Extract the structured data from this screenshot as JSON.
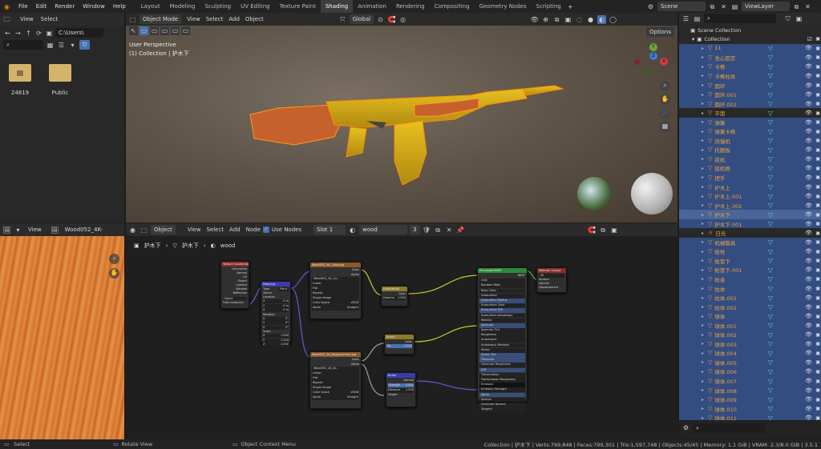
{
  "menu": [
    "File",
    "Edit",
    "Render",
    "Window",
    "Help"
  ],
  "workspaces": [
    "Layout",
    "Modeling",
    "Sculpting",
    "UV Editing",
    "Texture Paint",
    "Shading",
    "Animation",
    "Rendering",
    "Compositing",
    "Geometry Nodes",
    "Scripting"
  ],
  "active_workspace": "Shading",
  "scene": "Scene",
  "view_layer": "ViewLayer",
  "file_browser": {
    "menu": [
      "View",
      "Select"
    ],
    "path": "C:\\Users\\",
    "items": [
      {
        "name": "24819"
      },
      {
        "name": "Public"
      }
    ]
  },
  "viewport": {
    "mode": "Object Mode",
    "menu": [
      "View",
      "Select",
      "Add",
      "Object"
    ],
    "transform": "Global",
    "title": "User Perspective",
    "subtitle": "(1) Collection | 护木下",
    "options": "Options",
    "gizmo": {
      "y": "Y",
      "z": "Z",
      "x": "X"
    }
  },
  "image_editor": {
    "menu": "View",
    "image_name": "Wood052_4K-"
  },
  "node_editor": {
    "type": "Object",
    "menu": [
      "View",
      "Select",
      "Add",
      "Node"
    ],
    "use_nodes": "Use Nodes",
    "slot": "Slot 1",
    "material": "wood",
    "users": "3",
    "breadcrumb": [
      "护木下",
      "护木下",
      "wood"
    ],
    "nodes": {
      "texcoord": {
        "title": "Texture Coordinate",
        "outs": [
          "Generated",
          "Normal",
          "UV",
          "Object",
          "Camera",
          "Window",
          "Reflection"
        ],
        "object": "Object",
        "from": "From Instancer"
      },
      "mapping": {
        "title": "Mapping",
        "type_label": "Type",
        "type": "Point",
        "vector": "Vector",
        "location": "Location",
        "rotation": "Rotation",
        "scale": "Scale",
        "vals": [
          "0 m",
          "0 m",
          "0 m",
          "0°",
          "0°",
          "0°",
          "1.000",
          "1.000",
          "1.000"
        ],
        "axes": [
          "X",
          "Y",
          "Z",
          "X",
          "Y",
          "Z",
          "X",
          "Y",
          "Z"
        ]
      },
      "img1": {
        "title": "Wood052_4K_Color.jpg",
        "file": "Wood052_4K_Co...",
        "props": [
          "Linear",
          "Flat",
          "Repeat",
          "Single Image",
          "Color Space",
          "Alpha"
        ],
        "cs": "sRGB",
        "alpha": "Straight",
        "outs": [
          "Color",
          "Alpha"
        ]
      },
      "img2": {
        "title": "Wood052_4K_Displacement.jpg",
        "file": "Wood052_4K_Di...",
        "props": [
          "Linear",
          "Flat",
          "Repeat",
          "Single Image",
          "Color Space",
          "Alpha"
        ],
        "cs": "sRGB",
        "alpha": "Straight",
        "outs": [
          "Color",
          "Alpha"
        ]
      },
      "hsv": {
        "title": "Hue/Sat/Val",
        "color": "Color",
        "gamma": "Gamma",
        "gamma_val": "1.000"
      },
      "invert": {
        "title": "Invert",
        "fac": "Fac",
        "fac_val": "1.000",
        "color": "Color"
      },
      "bump": {
        "title": "Bump",
        "normal": "Normal",
        "strength": "Strength",
        "strength_val": "0.600",
        "distance": "Distance",
        "distance_val": "1.000",
        "height": "Height"
      },
      "bsdf": {
        "title": "Principled BSDF",
        "out": "BSDF",
        "rows": [
          "GGX",
          "Random Walk",
          "Base Color",
          "Subsurface",
          "Subsurface Radius",
          "Subsurface Color",
          "Subsurface IOR",
          "Subsurface Anisotropy",
          "Metallic",
          "Specular",
          "Specular Tint",
          "Roughness",
          "Anisotropic",
          "Anisotropic Rotation",
          "Sheen",
          "Sheen Tint",
          "Clearcoat",
          "Clearcoat Roughness",
          "IOR",
          "Transmission",
          "Transmission Roughness",
          "Emission",
          "Emission Strength",
          "Alpha",
          "Normal",
          "Clearcoat Normal",
          "Tangent"
        ]
      },
      "output": {
        "title": "Material Output",
        "target": "All",
        "ins": [
          "Surface",
          "Volume",
          "Displacement"
        ]
      }
    }
  },
  "outliner": {
    "scene_collection": "Scene Collection",
    "collection": "Collection",
    "items": [
      {
        "name": "11",
        "mod": true
      },
      {
        "name": "准心固定",
        "mod": true
      },
      {
        "name": "卡榫",
        "mod": true
      },
      {
        "name": "卡榫柱体",
        "mod": true
      },
      {
        "name": "圆环",
        "mod": true
      },
      {
        "name": "圆环.001",
        "mod": true
      },
      {
        "name": "圆环.002",
        "mod": true
      },
      {
        "name": "平面",
        "mod": true
      },
      {
        "name": "弹簧",
        "mod": true
      },
      {
        "name": "弹簧卡榫",
        "mod": true
      },
      {
        "name": "快慢机",
        "mod": true
      },
      {
        "name": "托腮板",
        "mod": true
      },
      {
        "name": "扳机",
        "mod": true
      },
      {
        "name": "扳机框",
        "mod": true
      },
      {
        "name": "把手",
        "mod": true
      },
      {
        "name": "护木上",
        "mod": true
      },
      {
        "name": "护木上.001",
        "mod": true
      },
      {
        "name": "护木上.002",
        "mod": true
      },
      {
        "name": "护木下",
        "mod": true
      },
      {
        "name": "护木下.001",
        "mod": true
      },
      {
        "name": "日光",
        "mod": false
      },
      {
        "name": "机械瞄具",
        "mod": true
      },
      {
        "name": "枪栓",
        "mod": true
      },
      {
        "name": "枪管下",
        "mod": true
      },
      {
        "name": "枪管下.001",
        "mod": true
      },
      {
        "name": "枪身",
        "mod": true
      },
      {
        "name": "柱体",
        "mod": true
      },
      {
        "name": "柱体.001",
        "mod": true
      },
      {
        "name": "柱体.002",
        "mod": true
      },
      {
        "name": "球体",
        "mod": true
      },
      {
        "name": "球体.001",
        "mod": true
      },
      {
        "name": "球体.002",
        "mod": true
      },
      {
        "name": "球体.003",
        "mod": true
      },
      {
        "name": "球体.004",
        "mod": true
      },
      {
        "name": "球体.005",
        "mod": true
      },
      {
        "name": "球体.006",
        "mod": true
      },
      {
        "name": "球体.007",
        "mod": true
      },
      {
        "name": "球体.008",
        "mod": true
      },
      {
        "name": "球体.009",
        "mod": true
      },
      {
        "name": "球体.010",
        "mod": true
      },
      {
        "name": "球体.011",
        "mod": true
      }
    ]
  },
  "status": {
    "select": "Select",
    "rotate": "Rotate View",
    "context": "Object Context Menu",
    "stats": "Collection | 护木下 | Verts:799,848 | Faces:799,301 | Tris:1,597,748 | Objects:45/45 | Memory: 1.1 GiB | VRAM: 2.3/8.0 GiB | 3.5.1"
  }
}
